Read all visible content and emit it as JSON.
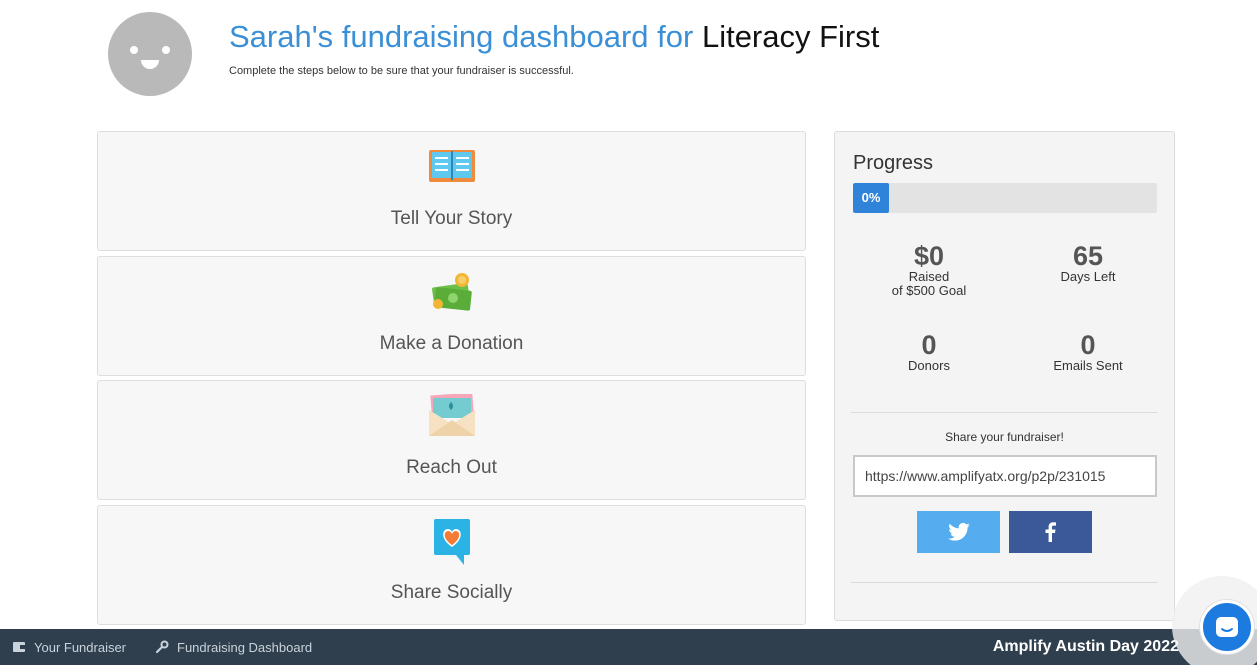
{
  "header": {
    "title_prefix": "Sarah's fundraising dashboard for",
    "title_org": "Literacy First",
    "subtitle": "Complete the steps below to be sure that your fundraiser is successful."
  },
  "steps": [
    {
      "label": "Tell Your Story",
      "icon": "open-book-icon"
    },
    {
      "label": "Make a Donation",
      "icon": "money-icon"
    },
    {
      "label": "Reach Out",
      "icon": "envelope-icon"
    },
    {
      "label": "Share Socially",
      "icon": "heart-speech-bubble-icon"
    }
  ],
  "progress": {
    "title": "Progress",
    "percent_label": "0%",
    "percent": 0,
    "raised_value": "$0",
    "raised_caption": "Raised",
    "goal_caption": "of $500 Goal",
    "days_value": "65",
    "days_caption": "Days Left",
    "donors_value": "0",
    "donors_caption": "Donors",
    "emails_value": "0",
    "emails_caption": "Emails Sent",
    "share_label": "Share your fundraiser!",
    "share_url": "https://www.amplifyatx.org/p2p/231015"
  },
  "bottombar": {
    "your_fundraiser": "Your Fundraiser",
    "dashboard": "Fundraising Dashboard",
    "event": "Amplify Austin Day 2022"
  },
  "colors": {
    "accent_blue": "#3a8fd6",
    "progress_fill": "#2f83d9",
    "twitter": "#55acee",
    "facebook": "#3b5998",
    "bottombar": "#2f3f4e"
  }
}
